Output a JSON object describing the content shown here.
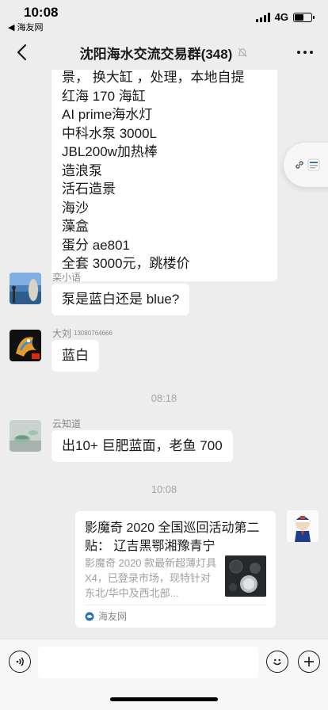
{
  "status": {
    "time": "10:08",
    "back_app": "◀ 海友网",
    "network": "4G"
  },
  "nav": {
    "title": "沈阳海水交流交易群(348)"
  },
  "messages": {
    "first_lines": [
      "景， 换大缸 ，处理，本地自提",
      "红海 170 海缸",
      "AI prime海水灯",
      "中科水泵 3000L",
      "JBL200w加热棒",
      "造浪泵",
      "活石造景",
      "海沙",
      "藻盒",
      "蛋分 ae801",
      "全套 3000元，跳楼价"
    ],
    "m1": {
      "sender": "栾小语",
      "text": "泵是蓝白还是 blue?"
    },
    "m2": {
      "sender": "大刘",
      "sender_note": "13080764666",
      "text": "蓝白"
    },
    "time1": "08:18",
    "m3": {
      "sender": "云知道",
      "text": "出10+ 巨肥蓝面，老鱼 700"
    },
    "time2": "10:08",
    "card": {
      "title": "影魔奇 2020 全国巡回活动第二贴： 辽吉黑鄂湘豫青宁",
      "desc": "影魔奇 2020 款最新超薄灯具 X4，已登录市场，现特针对东北/华中及西北部...",
      "source": "海友网"
    }
  },
  "colors": {
    "background": "#ededed",
    "bubble": "#ffffff",
    "meta_text": "#a3a3a3"
  }
}
